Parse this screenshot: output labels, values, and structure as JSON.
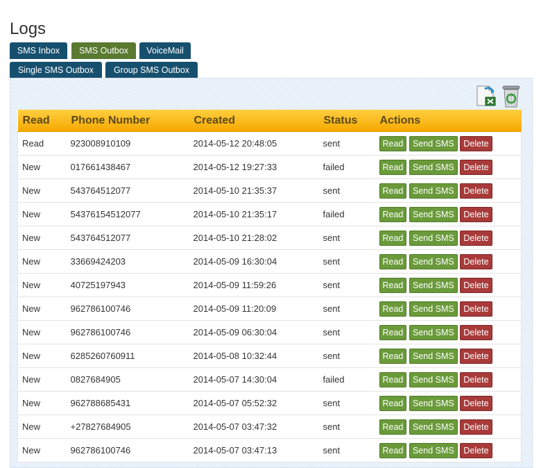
{
  "page": {
    "title": "Logs"
  },
  "tabs": [
    {
      "label": "SMS Inbox",
      "active": false
    },
    {
      "label": "SMS Outbox",
      "active": true
    },
    {
      "label": "VoiceMail",
      "active": false
    },
    {
      "label": "Single SMS Outbox",
      "active": false
    },
    {
      "label": "Group SMS Outbox",
      "active": false
    }
  ],
  "toolbar": {
    "export_icon": "excel-export-icon",
    "recycle_icon": "recycle-bin-icon"
  },
  "table": {
    "headers": [
      "Read",
      "Phone Number",
      "Created",
      "Status",
      "Actions"
    ],
    "action_labels": {
      "read": "Read",
      "send": "Send SMS",
      "delete": "Delete"
    },
    "rows": [
      {
        "read": "Read",
        "phone": "923008910109",
        "created": "2014-05-12 20:48:05",
        "status": "sent"
      },
      {
        "read": "New",
        "phone": "017661438467",
        "created": "2014-05-12 19:27:33",
        "status": "failed"
      },
      {
        "read": "New",
        "phone": "543764512077",
        "created": "2014-05-10 21:35:37",
        "status": "sent"
      },
      {
        "read": "New",
        "phone": "54376154512077",
        "created": "2014-05-10 21:35:17",
        "status": "failed"
      },
      {
        "read": "New",
        "phone": "543764512077",
        "created": "2014-05-10 21:28:02",
        "status": "sent"
      },
      {
        "read": "New",
        "phone": "33669424203",
        "created": "2014-05-09 16:30:04",
        "status": "sent"
      },
      {
        "read": "New",
        "phone": "40725197943",
        "created": "2014-05-09 11:59:26",
        "status": "sent"
      },
      {
        "read": "New",
        "phone": "962786100746",
        "created": "2014-05-09 11:20:09",
        "status": "sent"
      },
      {
        "read": "New",
        "phone": "962786100746",
        "created": "2014-05-09 06:30:04",
        "status": "sent"
      },
      {
        "read": "New",
        "phone": "6285260760911",
        "created": "2014-05-08 10:32:44",
        "status": "sent"
      },
      {
        "read": "New",
        "phone": "0827684905",
        "created": "2014-05-07 14:30:04",
        "status": "failed"
      },
      {
        "read": "New",
        "phone": "962788685431",
        "created": "2014-05-07 05:52:32",
        "status": "sent"
      },
      {
        "read": "New",
        "phone": "+27827684905",
        "created": "2014-05-07 03:47:32",
        "status": "sent"
      },
      {
        "read": "New",
        "phone": "962786100746",
        "created": "2014-05-07 03:47:13",
        "status": "sent"
      }
    ]
  },
  "colors": {
    "tab_blue": "#17506f",
    "tab_active": "#5a7a30",
    "header_gold": "#f6a800",
    "btn_green": "#6a9a3a",
    "btn_red": "#a83a3a"
  }
}
